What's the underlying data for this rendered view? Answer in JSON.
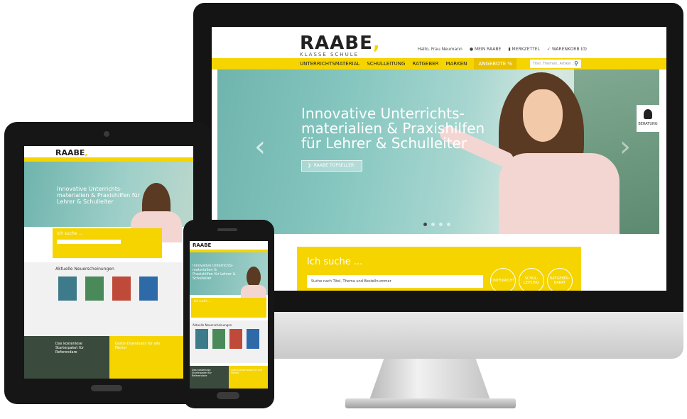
{
  "desktop": {
    "logo": {
      "main": "RAABE",
      "accent": ",",
      "sub": "KLASSE SCHULE"
    },
    "top_links": {
      "greeting": "Hallo, Frau Neumann",
      "my_account": "MEIN RAABE",
      "wishlist": "MERKZETTEL",
      "cart": "WARENKORB (0)"
    },
    "nav": [
      "UNTERRICHTSMATERIAL",
      "SCHULLEITUNG",
      "RATGEBER",
      "MARKEN",
      "ANGEBOTE %"
    ],
    "search_placeholder": "Titel, Themen, Artikel ...",
    "hero": {
      "title": "Innovative Unterrichts-materialien & Praxishilfen für Lehrer & Schulleiter",
      "button": "RAABE TOPSELLER",
      "arrow_left": "‹",
      "arrow_right": "›",
      "side_widget": "BERATUNG"
    },
    "search_box": {
      "title": "Ich suche ...",
      "input_value": "Suche nach Titel, Thema und Bestellnummer",
      "btn_1": "UNTERRICHT",
      "btn_2": "SCHUL-LEITUNG",
      "btn_3": "RATGEBER-BARAT"
    }
  },
  "tablet": {
    "logo": "RAABE",
    "hero_title": "Innovative Unterrichts-materialien & Praxishilfen für Lehrer & Schulleiter",
    "search_title": "Ich suche ...",
    "news_title": "Aktuelle Neuerscheinungen",
    "promo_left": "Das kostenlose Starterpaket für Referendare",
    "promo_right": "Gratis-Downloads für alle Fächer"
  },
  "phone": {
    "logo": "RAABE",
    "hero_title": "Innovative Unterrichts-materialien & Praxishilfen für Lehrer & Schulleiter",
    "search_title": "Ich suche ...",
    "news_title": "Aktuelle Neuerscheinungen",
    "promo_left": "Das kostenlose Starterpaket für Referendare",
    "promo_right": "Gratis-Downloads für alle Fächer"
  },
  "colors": {
    "brand_yellow": "#f5d400",
    "dark": "#161616",
    "hero_teal": "#6fb4ad"
  }
}
